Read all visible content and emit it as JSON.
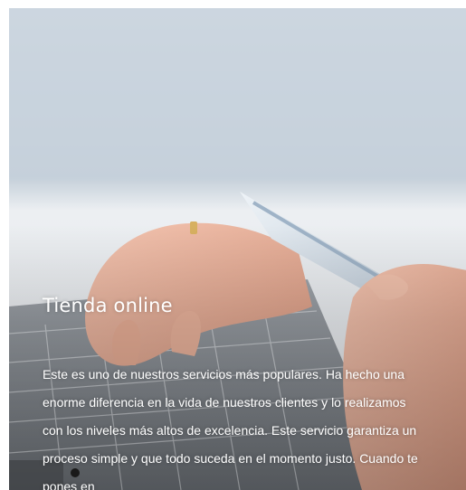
{
  "card": {
    "title": "Tienda online",
    "description": "Este es uno de nuestros servicios más populares. Ha hecho una enorme diferencia en la vida de nuestros clientes y lo realizamos con los niveles más altos de excelencia. Este servicio garantiza un proceso simple y que todo suceda en el momento justo. Cuando te pones en",
    "image": "hands-laptop-credit-card-photo"
  },
  "colors": {
    "title_text": "#ffffff",
    "body_text": "#ffffff",
    "sky": "#c9d5df",
    "laptop": "#8b8f94",
    "skin": "#e8b09a"
  }
}
